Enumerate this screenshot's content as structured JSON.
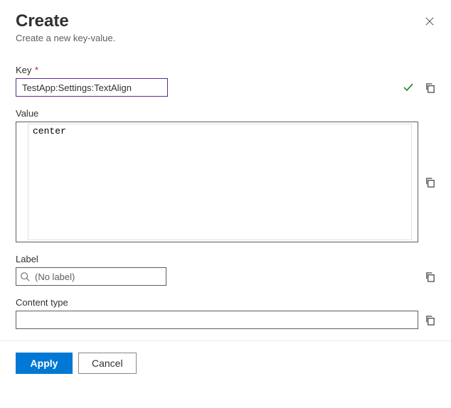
{
  "header": {
    "title": "Create",
    "subtitle": "Create a new key-value."
  },
  "fields": {
    "key": {
      "label": "Key",
      "value": "TestApp:Settings:TextAlign"
    },
    "value": {
      "label": "Value",
      "content": "center"
    },
    "label": {
      "label": "Label",
      "placeholder": "(No label)",
      "value": ""
    },
    "contentType": {
      "label": "Content type",
      "value": ""
    }
  },
  "buttons": {
    "apply": "Apply",
    "cancel": "Cancel"
  }
}
